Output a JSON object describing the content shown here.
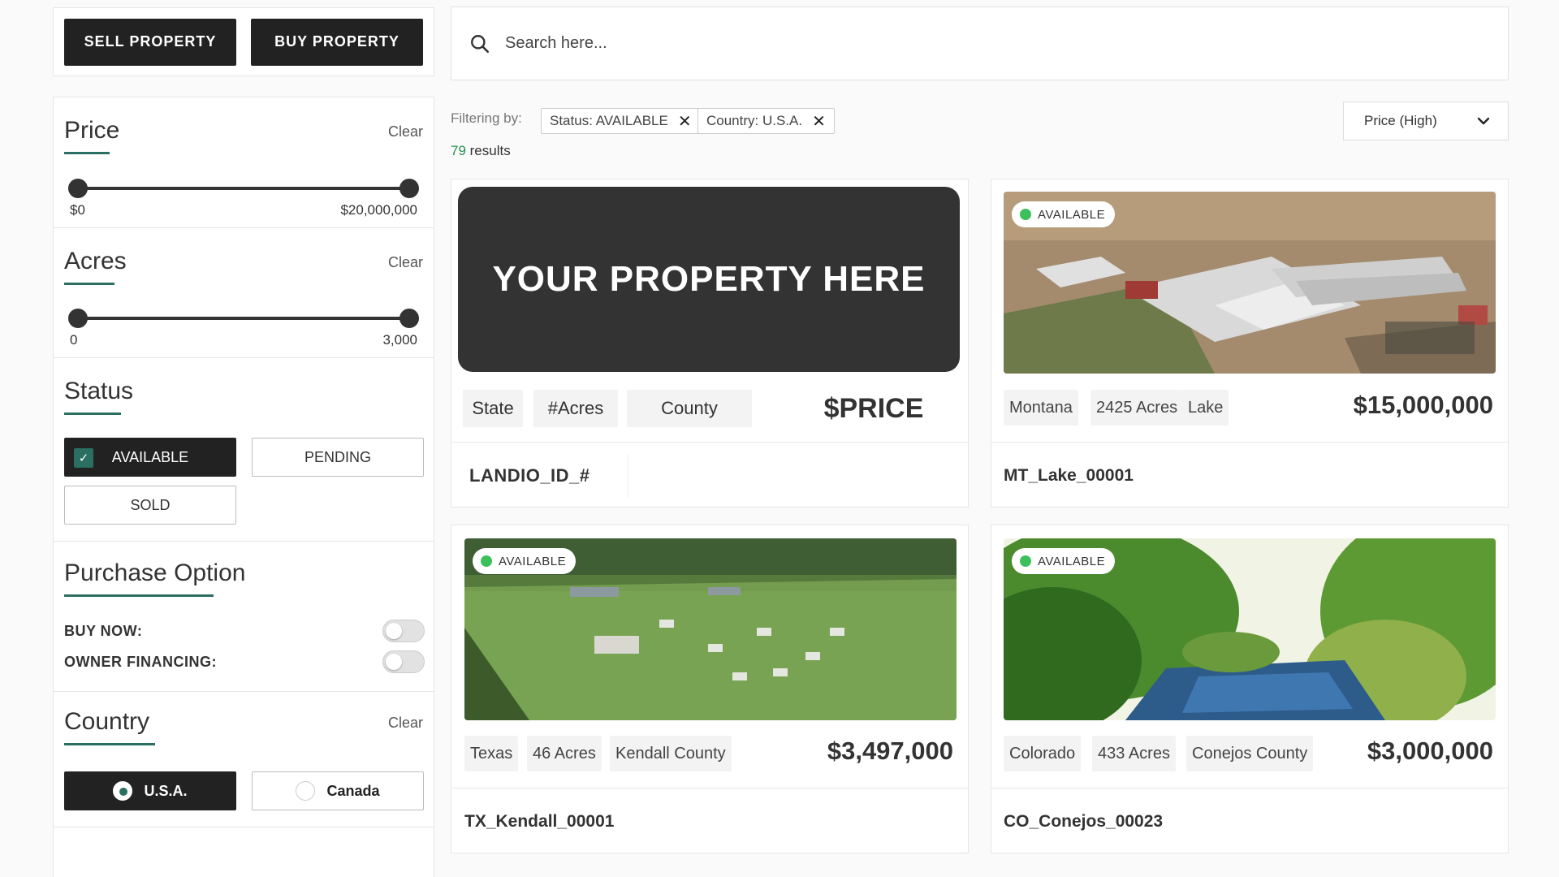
{
  "topbar": {
    "sell_label": "SELL PROPERTY",
    "buy_label": "BUY PROPERTY"
  },
  "search": {
    "placeholder": "Search here..."
  },
  "filters": {
    "price": {
      "title": "Price",
      "clear": "Clear",
      "min_label": "$0",
      "max_label": "$20,000,000"
    },
    "acres": {
      "title": "Acres",
      "clear": "Clear",
      "min_label": "0",
      "max_label": "3,000"
    },
    "status": {
      "title": "Status",
      "options": [
        "AVAILABLE",
        "PENDING",
        "SOLD"
      ],
      "selected": "AVAILABLE"
    },
    "purchase": {
      "title": "Purchase Option",
      "buy_now": "BUY NOW:",
      "owner_financing": "OWNER FINANCING:"
    },
    "country": {
      "title": "Country",
      "clear": "Clear",
      "options": [
        "U.S.A.",
        "Canada"
      ],
      "selected": "U.S.A."
    }
  },
  "filterbar": {
    "label": "Filtering by:",
    "chips": [
      "Status: AVAILABLE",
      "Country: U.S.A."
    ],
    "result_count": "79",
    "result_suffix": " results",
    "sort": "Price (High)"
  },
  "placeholder_card": {
    "banner": "YOUR PROPERTY HERE",
    "state": "State",
    "acres": "#Acres",
    "county": "County",
    "price": "$PRICE",
    "id": "LANDIO_ID_#"
  },
  "listings": [
    {
      "badge": "AVAILABLE",
      "state": "Montana",
      "acres": "2425 Acres",
      "county": "Lake",
      "price": "$15,000,000",
      "id": "MT_Lake_00001"
    },
    {
      "badge": "AVAILABLE",
      "state": "Texas",
      "acres": "46 Acres",
      "county": "Kendall County",
      "price": "$3,497,000",
      "id": "TX_Kendall_00001"
    },
    {
      "badge": "AVAILABLE",
      "state": "Colorado",
      "acres": "433 Acres",
      "county": "Conejos County",
      "price": "$3,000,000",
      "id": "CO_Conejos_00023"
    }
  ],
  "colors": {
    "accent": "#2a6f62",
    "dark": "#222222",
    "available_dot": "#3cc05b"
  }
}
